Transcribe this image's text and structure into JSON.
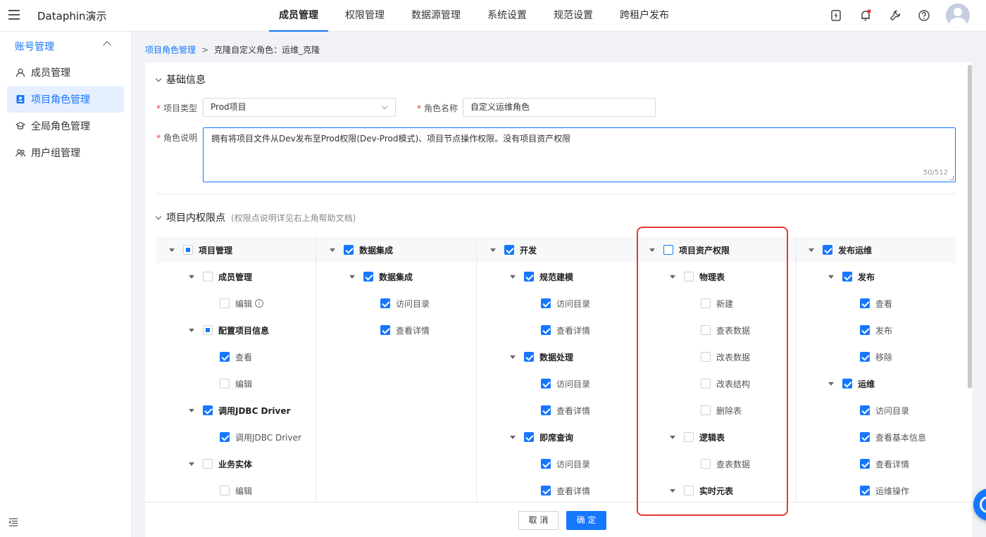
{
  "app": {
    "title": "Dataphin演示"
  },
  "nav": [
    "成员管理",
    "权限管理",
    "数据源管理",
    "系统设置",
    "规范设置",
    "跨租户发布"
  ],
  "icons": {
    "menu": "menu-icon",
    "bolt": "bolt-file-icon",
    "bell": "bell-icon",
    "wrench": "wrench-icon",
    "help": "help-circle-icon",
    "avatar": "user-avatar-icon"
  },
  "sidebar": {
    "group": "账号管理",
    "items": [
      "成员管理",
      "项目角色管理",
      "全局角色管理",
      "用户组管理"
    ]
  },
  "breadcrumb": {
    "link": "项目角色管理",
    "separator": ">",
    "current": "克隆自定义角色：运维_克隆"
  },
  "basic": {
    "title": "基础信息",
    "project_type_label": "项目类型",
    "project_type_value": "Prod项目",
    "role_name_label": "角色名称",
    "role_name_value": "自定义运维角色",
    "desc_label": "角色说明",
    "desc_value": "拥有将项目文件从Dev发布至Prod权限(Dev-Prod模式)、项目节点操作权限。没有项目资产权限",
    "desc_counter": "50/512"
  },
  "perm": {
    "title": "项目内权限点",
    "hint": "(权限点说明详见右上角帮助文档)",
    "col1": {
      "root": "项目管理",
      "n1": "成员管理",
      "n1a": "编辑",
      "info": "i",
      "n2": "配置项目信息",
      "n2a": "查看",
      "n2b": "编辑",
      "n3": "调用JDBC Driver",
      "n3a": "调用JDBC Driver",
      "n4": "业务实体",
      "n4a": "编辑"
    },
    "col2": {
      "root": "数据集成",
      "n1": "数据集成",
      "n1a": "访问目录",
      "n1b": "查看详情"
    },
    "col3": {
      "root": "开发",
      "n1": "规范建模",
      "n1a": "访问目录",
      "n1b": "查看详情",
      "n2": "数据处理",
      "n2a": "访问目录",
      "n2b": "查看详情",
      "n3": "即席查询",
      "n3a": "访问目录",
      "n3b": "查看详情"
    },
    "col4": {
      "root": "项目资产权限",
      "n1": "物理表",
      "n1a": "新建",
      "n1b": "查表数据",
      "n1c": "改表数据",
      "n1d": "改表结构",
      "n1e": "删除表",
      "n2": "逻辑表",
      "n2a": "查表数据",
      "n3": "实时元表"
    },
    "col5": {
      "root": "发布运维",
      "n1": "发布",
      "n1a": "查看",
      "n1b": "发布",
      "n1c": "移除",
      "n2": "运维",
      "n2a": "访问目录",
      "n2b": "查看基本信息",
      "n2c": "查看详情",
      "n2d": "运维操作"
    }
  },
  "buttons": {
    "cancel": "取 消",
    "ok": "确 定"
  },
  "colors": {
    "accent": "#1677ff",
    "highlight": "#e53935"
  }
}
